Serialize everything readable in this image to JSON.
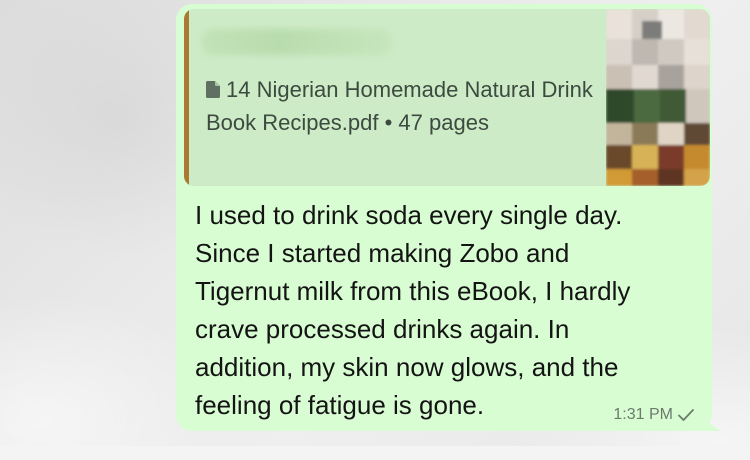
{
  "message": {
    "document": {
      "sender_name": "",
      "file_name": "14 Nigerian Homemade Natural Drink Book Recipes.pdf",
      "separator": "•",
      "page_count": "47",
      "pages_label": "pages",
      "icon": "document-icon",
      "thumbnail": "blurred-cover-thumbnail"
    },
    "text_lines": [
      "I used to drink soda every single day.",
      "Since I started making Zobo and",
      "Tigernut milk from this eBook, I hardly",
      "crave processed drinks again. In",
      "addition, my skin now glows, and the",
      "feeling of fatigue is gone."
    ],
    "time": "1:31 PM",
    "status_icon": "single-check-icon"
  },
  "colors": {
    "bubble": "#d9fdd3",
    "doc_card": "#cdebc6",
    "doc_accent": "#a97a31",
    "meta": "#6b7b6c"
  }
}
